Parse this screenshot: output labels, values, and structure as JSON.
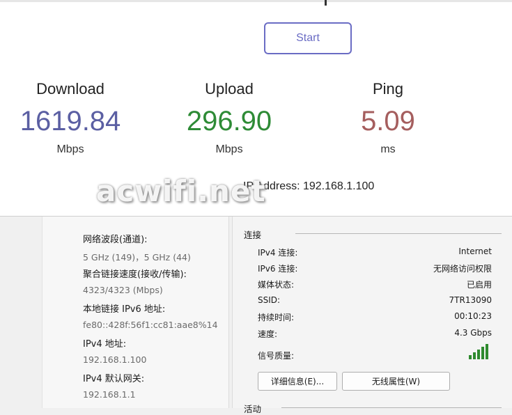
{
  "speedtest": {
    "start_label": "Start",
    "download": {
      "label": "Download",
      "value": "1619.84",
      "unit": "Mbps",
      "color": "#5b5fa3"
    },
    "upload": {
      "label": "Upload",
      "value": "296.90",
      "unit": "Mbps",
      "color": "#2e8b36"
    },
    "ping": {
      "label": "Ping",
      "value": "5.09",
      "unit": "ms",
      "color": "#a55e5e"
    },
    "ip_address": "IP Address: 192.168.1.100",
    "accent": "#6a6cc4"
  },
  "watermark": "acwifi.net",
  "properties": [
    {
      "key": "网络波段(通道):",
      "value": "5 GHz (149)，5 GHz (44)"
    },
    {
      "key": "聚合链接速度(接收/传输):",
      "value": "4323/4323 (Mbps)"
    },
    {
      "key": "本地链接 IPv6 地址:",
      "value": "fe80::428f:56f1:cc81:aae8%14"
    },
    {
      "key": "IPv4 地址:",
      "value": "192.168.1.100"
    },
    {
      "key": "IPv4 默认网关:",
      "value": "192.168.1.1"
    }
  ],
  "status": {
    "group_title": "连接",
    "rows": [
      {
        "key": "IPv4 连接:",
        "value": "Internet"
      },
      {
        "key": "IPv6 连接:",
        "value": "无网络访问权限"
      },
      {
        "key": "媒体状态:",
        "value": "已启用"
      },
      {
        "key": "SSID:",
        "value": "7TR13090"
      },
      {
        "key": "持续时间:",
        "value": "00:10:23"
      },
      {
        "key": "速度:",
        "value": "4.3 Gbps"
      }
    ],
    "signal_label": "信号质量:",
    "signal_icon": "signal-bars-icon",
    "signal_bars": 5,
    "signal_bars_lit": 5,
    "details_button": "详细信息(E)...",
    "wireless_button": "无线属性(W)",
    "activity_title": "活动"
  }
}
